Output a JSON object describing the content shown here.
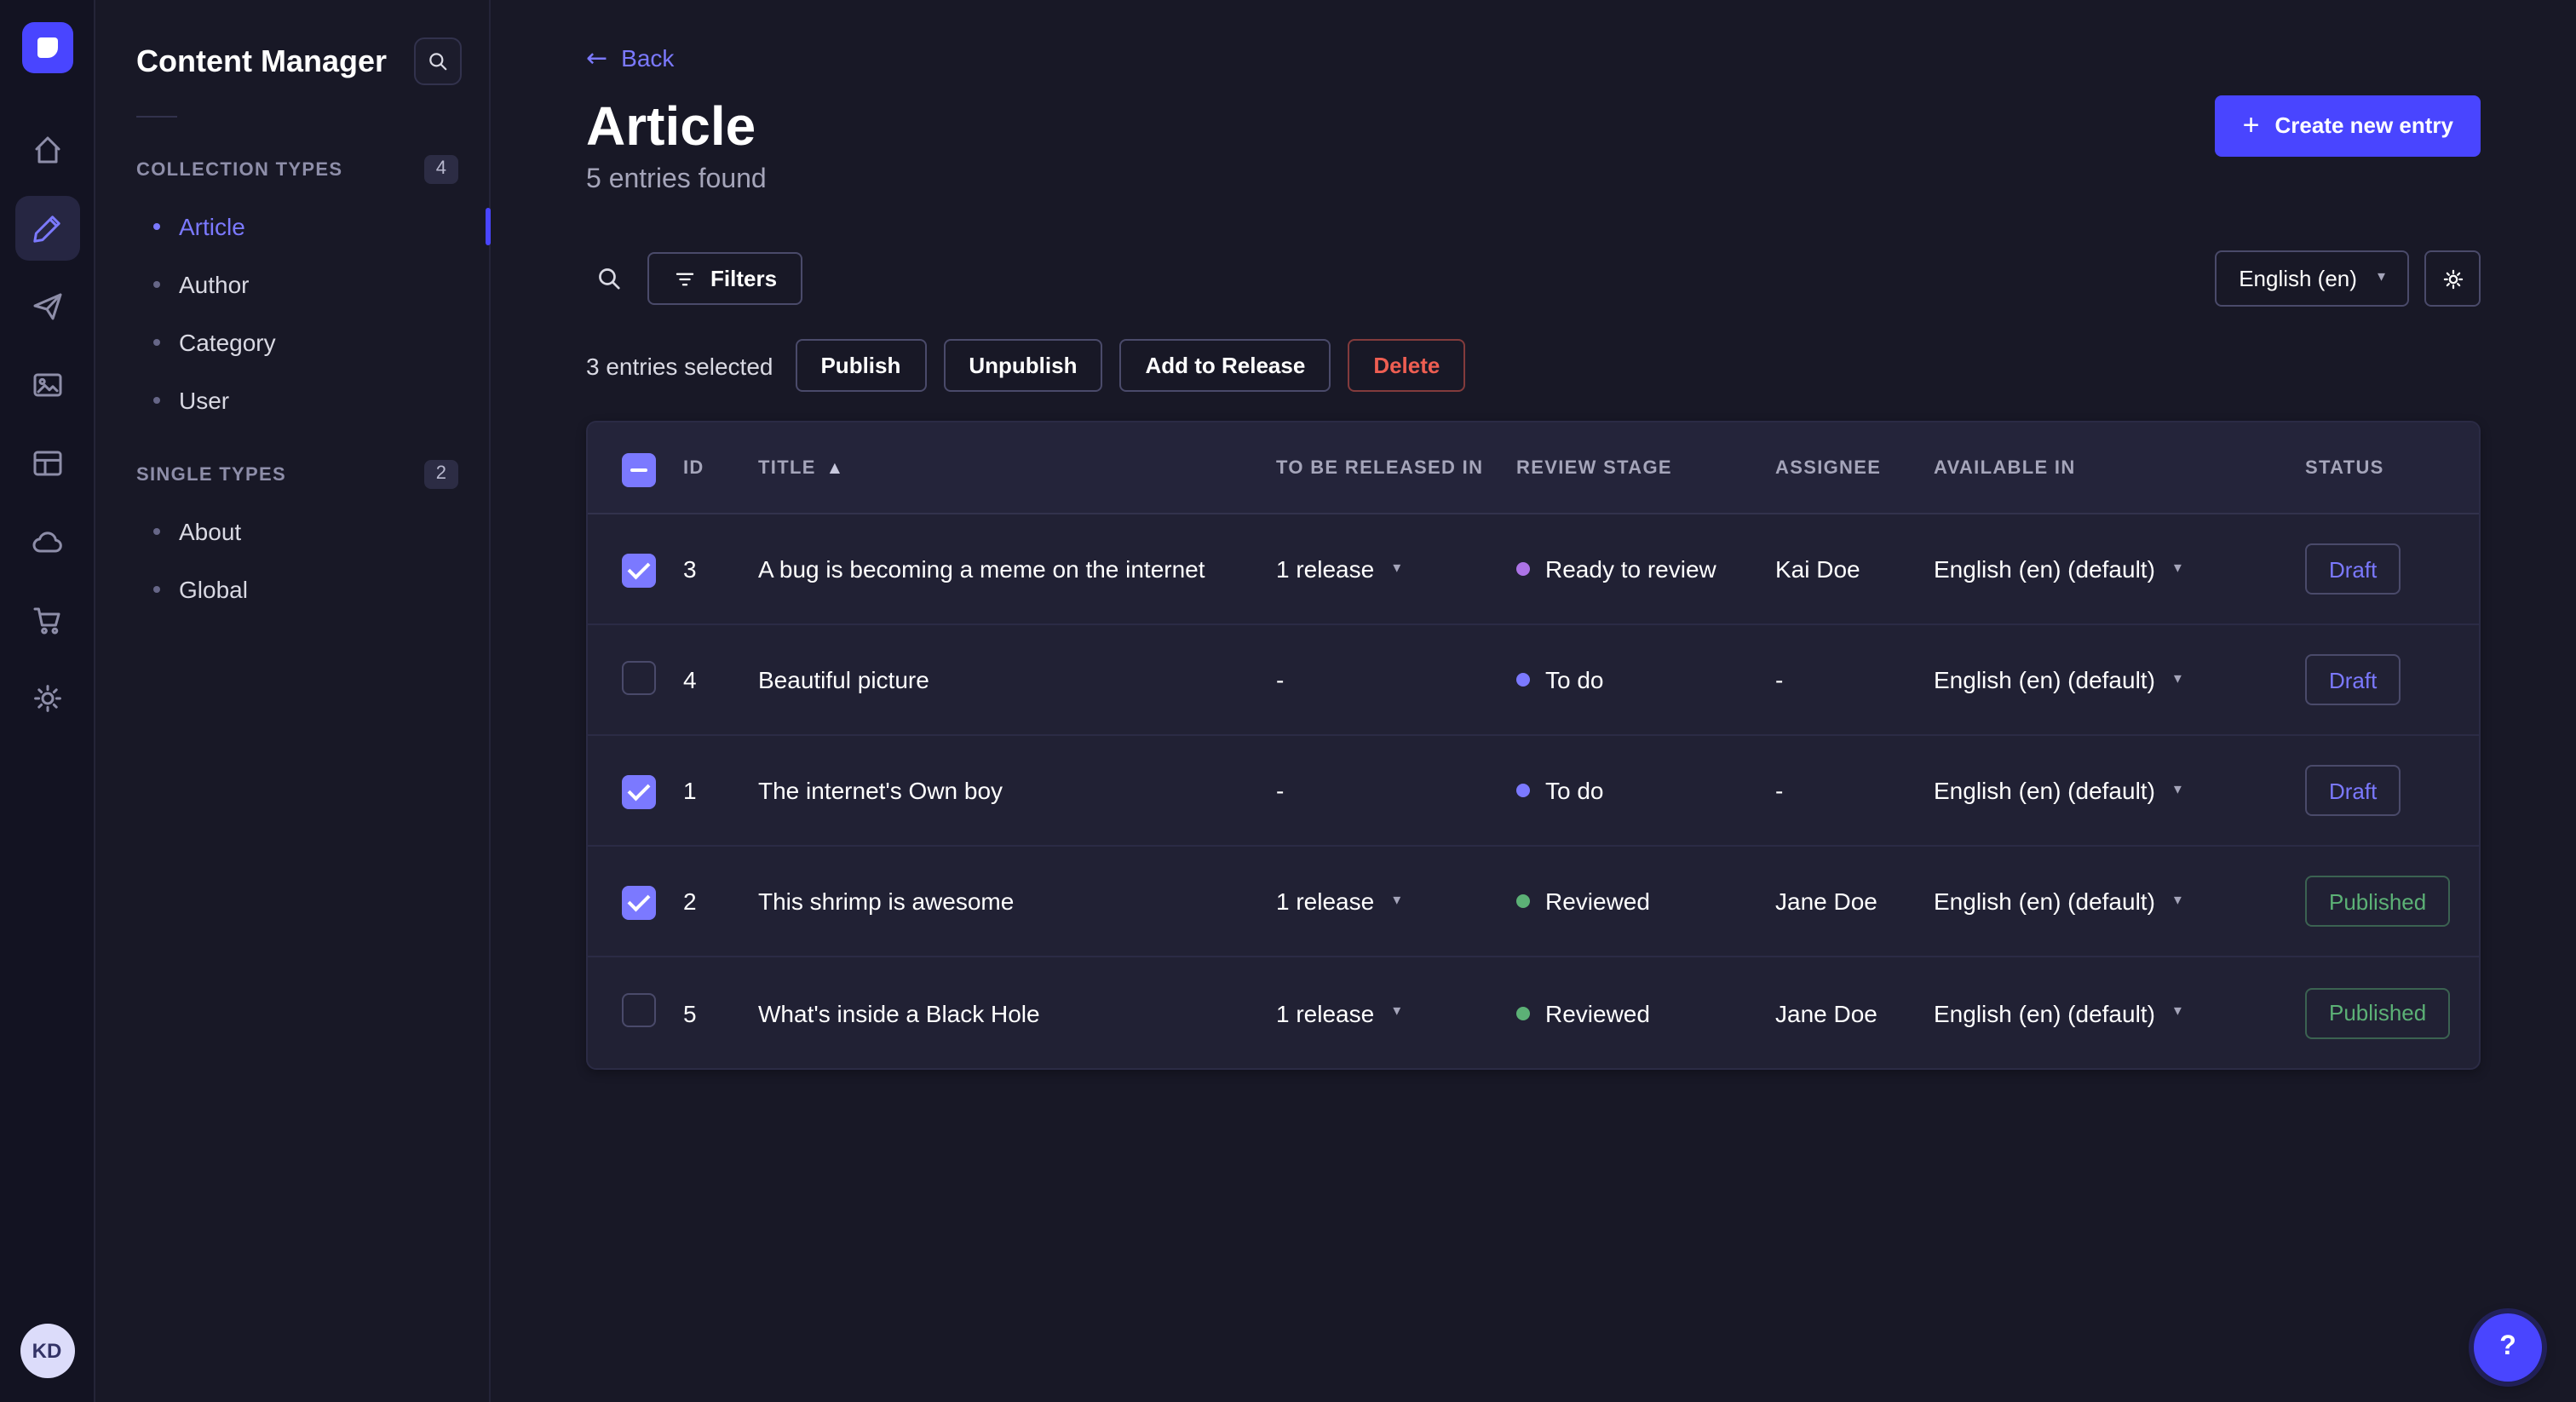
{
  "user": {
    "initials": "KD"
  },
  "icons": {
    "back_arrow": "←",
    "caret_down": "▾",
    "sort_asc": "▲",
    "plus": "+",
    "help": "?"
  },
  "sidebar": {
    "title": "Content Manager",
    "sections": [
      {
        "label": "COLLECTION TYPES",
        "badge": "4",
        "items": [
          {
            "label": "Article",
            "active": true
          },
          {
            "label": "Author"
          },
          {
            "label": "Category"
          },
          {
            "label": "User"
          }
        ]
      },
      {
        "label": "SINGLE TYPES",
        "badge": "2",
        "items": [
          {
            "label": "About"
          },
          {
            "label": "Global"
          }
        ]
      }
    ]
  },
  "header": {
    "back_label": "Back",
    "title": "Article",
    "subtitle": "5 entries found",
    "create_button_label": "Create new entry"
  },
  "toolbar": {
    "filters_label": "Filters",
    "locale": "English (en)"
  },
  "selection": {
    "count_label": "3 entries selected",
    "publish_label": "Publish",
    "unpublish_label": "Unpublish",
    "add_to_release_label": "Add to Release",
    "delete_label": "Delete"
  },
  "table": {
    "columns": [
      "ID",
      "TITLE",
      "TO BE RELEASED IN",
      "REVIEW STAGE",
      "ASSIGNEE",
      "AVAILABLE IN",
      "STATUS"
    ],
    "rows": [
      {
        "selected": true,
        "id": "3",
        "title": "A bug is becoming a meme on the internet",
        "release": "1 release",
        "review_stage": "Ready to review",
        "stage_color": "#ac73e6",
        "assignee": "Kai Doe",
        "locale": "English (en) (default)",
        "status": "Draft"
      },
      {
        "selected": false,
        "id": "4",
        "title": "Beautiful picture",
        "release": "-",
        "review_stage": "To do",
        "stage_color": "#7b79ff",
        "assignee": "-",
        "locale": "English (en) (default)",
        "status": "Draft"
      },
      {
        "selected": true,
        "id": "1",
        "title": "The internet's Own boy",
        "release": "-",
        "review_stage": "To do",
        "stage_color": "#7b79ff",
        "assignee": "-",
        "locale": "English (en) (default)",
        "status": "Draft"
      },
      {
        "selected": true,
        "id": "2",
        "title": "This shrimp is awesome",
        "release": "1 release",
        "review_stage": "Reviewed",
        "stage_color": "#5cb176",
        "assignee": "Jane Doe",
        "locale": "English (en) (default)",
        "status": "Published"
      },
      {
        "selected": false,
        "id": "5",
        "title": "What's inside a Black Hole",
        "release": "1 release",
        "review_stage": "Reviewed",
        "stage_color": "#5cb176",
        "assignee": "Jane Doe",
        "locale": "English (en) (default)",
        "status": "Published"
      }
    ]
  },
  "colors": {
    "accent": "#4945ff",
    "accent_light": "#7b79ff",
    "success": "#5cb176",
    "danger": "#ee5e52",
    "stage_ready_to_review": "#ac73e6",
    "stage_to_do": "#7b79ff",
    "stage_reviewed": "#5cb176"
  }
}
